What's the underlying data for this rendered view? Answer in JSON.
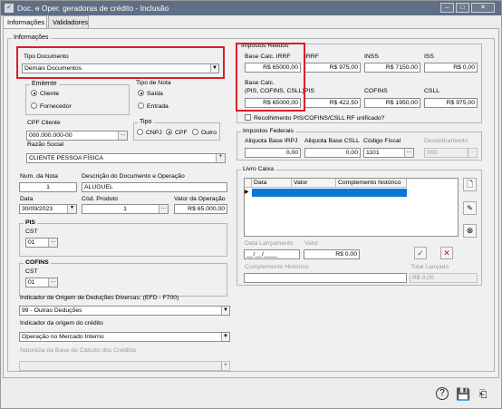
{
  "window": {
    "title": "Doc. e Oper. geradoras de crédito - Inclusão"
  },
  "tabs": [
    "Informações",
    "Validadores"
  ],
  "info_group": "Informações",
  "tipo_documento": {
    "label": "Tipo Documento",
    "value": "Demais Documentos"
  },
  "emitente": {
    "label": "Emitente",
    "options": [
      "Cliente",
      "Fornecedor"
    ]
  },
  "tipo_nota": {
    "label": "Tipo de Nota",
    "options": [
      "Saída",
      "Entrada"
    ]
  },
  "cpf_cliente": {
    "label": "CPF Cliente",
    "value": "000.000.000-00"
  },
  "tipo": {
    "label": "Tipo",
    "options": [
      "CNPJ",
      "CPF",
      "Outro"
    ]
  },
  "razao_social": {
    "label": "Razão Social",
    "value": "CLIENTE PESSOA FÍSICA"
  },
  "num_nota": {
    "label": "Num. da Nota",
    "value": "1"
  },
  "descricao": {
    "label": "Descrição do Documento e Operação",
    "value": "ALUGUEL"
  },
  "data": {
    "label": "Data",
    "value": "30/09/2023"
  },
  "cod_produto": {
    "label": "Cód. Produto",
    "value": "1"
  },
  "valor_operacao": {
    "label": "Valor da Operação",
    "value": "R$ 65.000,00"
  },
  "pis": {
    "title": "PIS",
    "cst_label": "CST",
    "cst_value": "01"
  },
  "cofins": {
    "title": "COFINS",
    "cst_label": "CST",
    "cst_value": "01"
  },
  "indicador_origem": {
    "label": "Indicador de Origem de Deduções Diversas: (EFD - F700)",
    "value": "99 - Outras Deduções"
  },
  "indicador_credito": {
    "label": "Indicador da origem do crédito",
    "value": "Operação no Mercado Interno"
  },
  "natureza_base": {
    "label": "Natureza da Base de Cálculo dos Créditos",
    "value": ""
  },
  "impostos_retidos": {
    "title": "Impostos Retidos",
    "base_irrf_label": "Base Calc. IRRF",
    "base_irrf": "R$ 65000,00",
    "irrf_label": "IRRF",
    "irrf": "R$ 975,00",
    "inss_label": "INSS",
    "inss": "R$ 7150,00",
    "iss_label": "ISS",
    "iss": "R$ 0,00",
    "base_pis_label_1": "Base Calc.",
    "base_pis_label_2": "(PIS, COFINS, CSLL)",
    "base_pis": "R$ 65000,00",
    "pis_label": "PIS",
    "pis": "R$ 422,50",
    "cofins_label": "COFINS",
    "cofins": "R$ 1950,00",
    "csll_label": "CSLL",
    "csll": "R$ 975,00",
    "recolhimento_label": "Recolhimento PIS/COFINS/CSLL RF unificado?"
  },
  "impostos_federais": {
    "title": "Impostos Federais",
    "aliq_irpj_label": "Aliquota Base IRPJ",
    "aliq_irpj": "0,00",
    "aliq_csll_label": "Aliquota Base CSLL",
    "aliq_csll": "0,00",
    "cod_fiscal_label": "Código Fiscal",
    "cod_fiscal": "1101",
    "desdobramento_label": "Desdobramento",
    "desdobramento": "000"
  },
  "livro_caixa": {
    "title": "Livro Caixa",
    "columns": [
      "Data",
      "Valor",
      "Complemento histórico"
    ],
    "data_lancamento_label": "Data Lançamento",
    "data_lancamento": "__/__/____",
    "valor_label": "Valor",
    "valor": "R$ 0,00",
    "complemento_label": "Complemento Histórico",
    "total_label": "Total Lançado",
    "total": "R$ 0,00"
  }
}
